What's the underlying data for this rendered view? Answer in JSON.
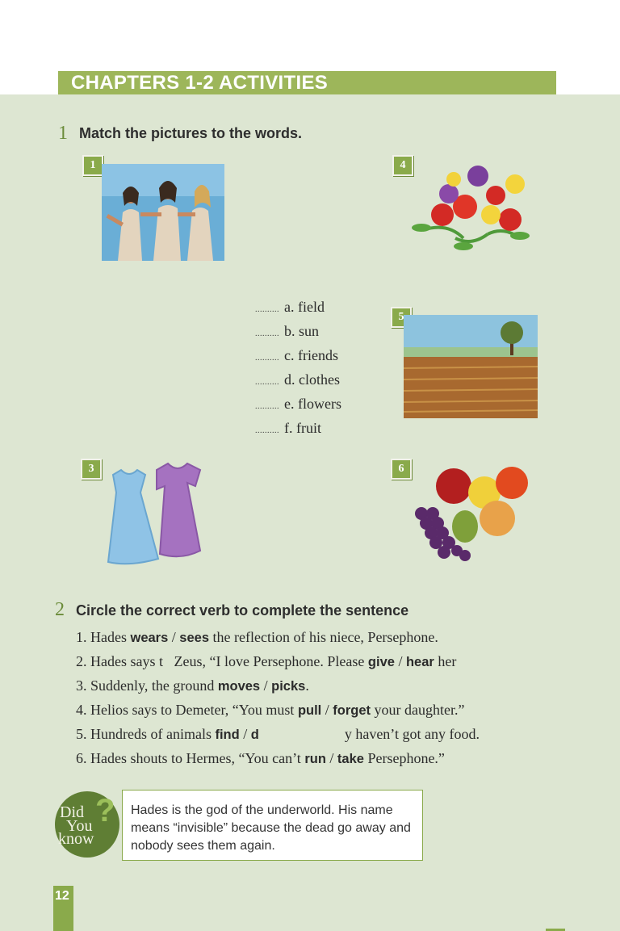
{
  "title": "CHAPTERS 1-2 ACTIVITIES",
  "activity1": {
    "number": "1",
    "instruction": "Match the pictures to the words.",
    "pictures": [
      {
        "label": "1",
        "icon": "three-girls-illustration"
      },
      {
        "label": "4",
        "icon": "flowers-illustration"
      },
      {
        "label": "5",
        "icon": "field-illustration"
      },
      {
        "label": "3",
        "icon": "dresses-illustration"
      },
      {
        "label": "6",
        "icon": "fruit-illustration"
      }
    ],
    "blank": "..........",
    "words": [
      "a. field",
      "b. sun",
      "c. friends",
      "d. clothes",
      "e. flowers",
      "f. fruit"
    ]
  },
  "activity2": {
    "number": "2",
    "instruction": "Circle the correct verb to complete the sentence",
    "sentences": [
      {
        "n": "1.",
        "pre": "Hades ",
        "v1": "wears",
        "sep": " / ",
        "v2": "sees",
        "post": " the reflection of his niece, Persephone."
      },
      {
        "n": "2.",
        "pre": "Hades says t   Zeus, “I love Persephone. Please ",
        "v1": "give",
        "sep": " / ",
        "v2": "hear",
        "post": " her"
      },
      {
        "n": "3.",
        "pre": "Suddenly, the ground ",
        "v1": "moves",
        "sep": " / ",
        "v2": "picks",
        "post": "."
      },
      {
        "n": "4.",
        "pre": "Helios says to Demeter, “You must ",
        "v1": "pull",
        "sep": " / ",
        "v2": "forget",
        "post": " your daughter.”"
      },
      {
        "n": "5.",
        "pre": "Hundreds of animals ",
        "v1": "find",
        "sep": " / ",
        "v2": "d",
        "post": "y haven’t got any food."
      },
      {
        "n": "6.",
        "pre": "Hades shouts to Hermes, “You can’t ",
        "v1": "run",
        "sep": " / ",
        "v2": "take",
        "post": " Persephone.”"
      }
    ]
  },
  "did_you_know": {
    "badge_line1": "Did",
    "badge_line2": "You",
    "badge_line3": "know",
    "badge_mark": "?",
    "text": "Hades is the god of the underworld. His name means “invisible” because the dead go away and nobody sees them again."
  },
  "page_number": "12",
  "colors": {
    "accent": "#8aaa4b",
    "background": "#dde6d2",
    "title_bar": "#9db65a"
  }
}
